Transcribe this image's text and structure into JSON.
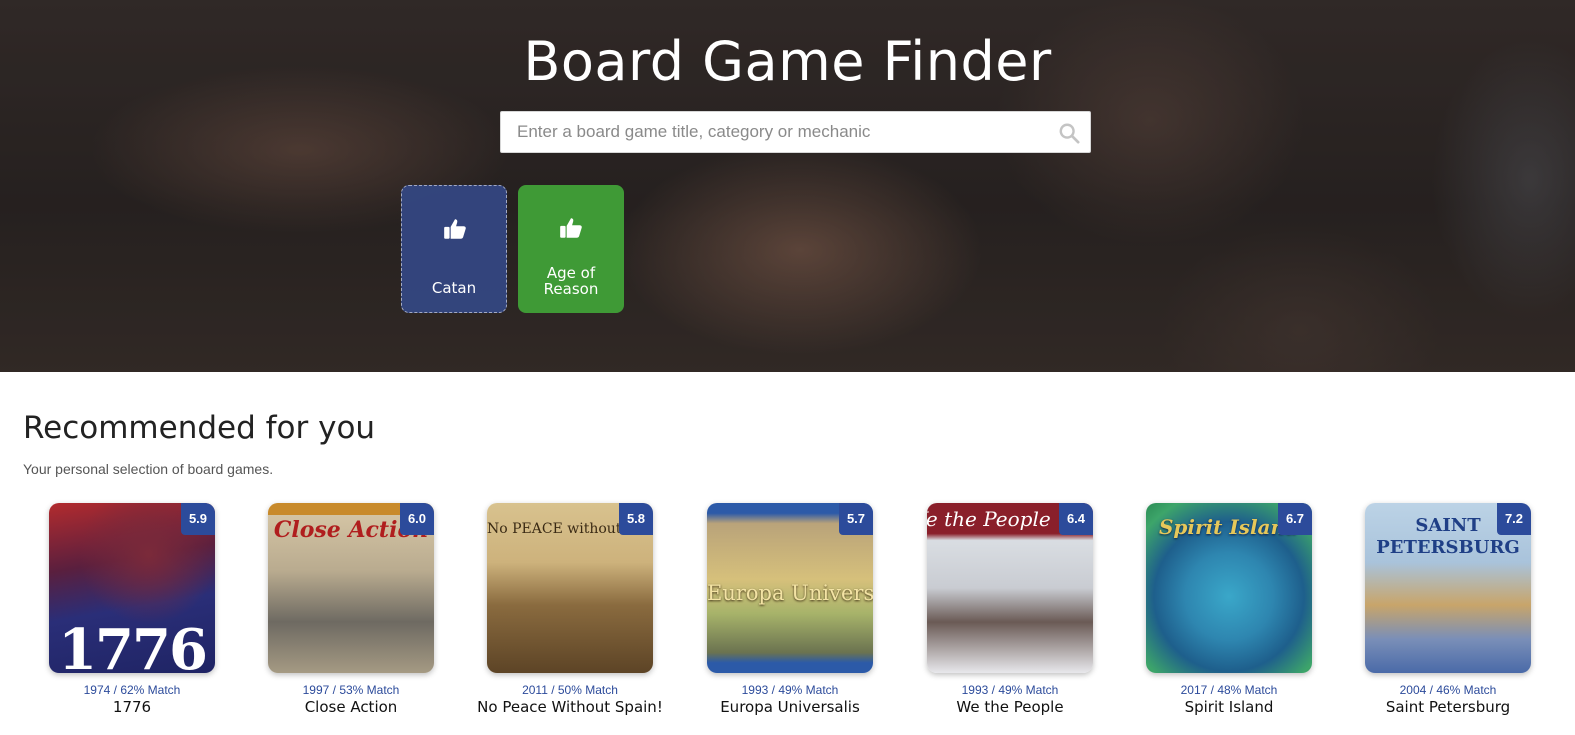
{
  "hero": {
    "title": "Board Game Finder",
    "search_placeholder": "Enter a board game title, category or mechanic",
    "search_icon": "search-icon",
    "liked": [
      {
        "label": "Catan",
        "icon": "thumbs-up-icon",
        "color": "#344884"
      },
      {
        "label": "Age of Reason",
        "icon": "thumbs-up-icon",
        "color": "#3f9a36"
      }
    ]
  },
  "recommended": {
    "title": "Recommended for you",
    "subtitle": "Your personal selection of board games.",
    "games": [
      {
        "name": "1776",
        "meta": "1974 / 62% Match",
        "rating": "5.9",
        "cover_text": "1776"
      },
      {
        "name": "Close Action",
        "meta": "1997 / 53% Match",
        "rating": "6.0",
        "cover_text": "Close Action"
      },
      {
        "name": "No Peace Without Spain!",
        "meta": "2011 / 50% Match",
        "rating": "5.8",
        "cover_text": "No PEACE without SPAIN"
      },
      {
        "name": "Europa Universalis",
        "meta": "1993 / 49% Match",
        "rating": "5.7",
        "cover_text": "Europa Universalis"
      },
      {
        "name": "We the People",
        "meta": "1993 / 49% Match",
        "rating": "6.4",
        "cover_text": "We the People"
      },
      {
        "name": "Spirit Island",
        "meta": "2017 / 48% Match",
        "rating": "6.7",
        "cover_text": "Spirit Island"
      },
      {
        "name": "Saint Petersburg",
        "meta": "2004 / 46% Match",
        "rating": "7.2",
        "cover_text": "SAINT PETERSBURG"
      }
    ]
  },
  "colors": {
    "accent": "#2c4b9b",
    "liked_green": "#3f9a36",
    "liked_blue": "#344884"
  }
}
